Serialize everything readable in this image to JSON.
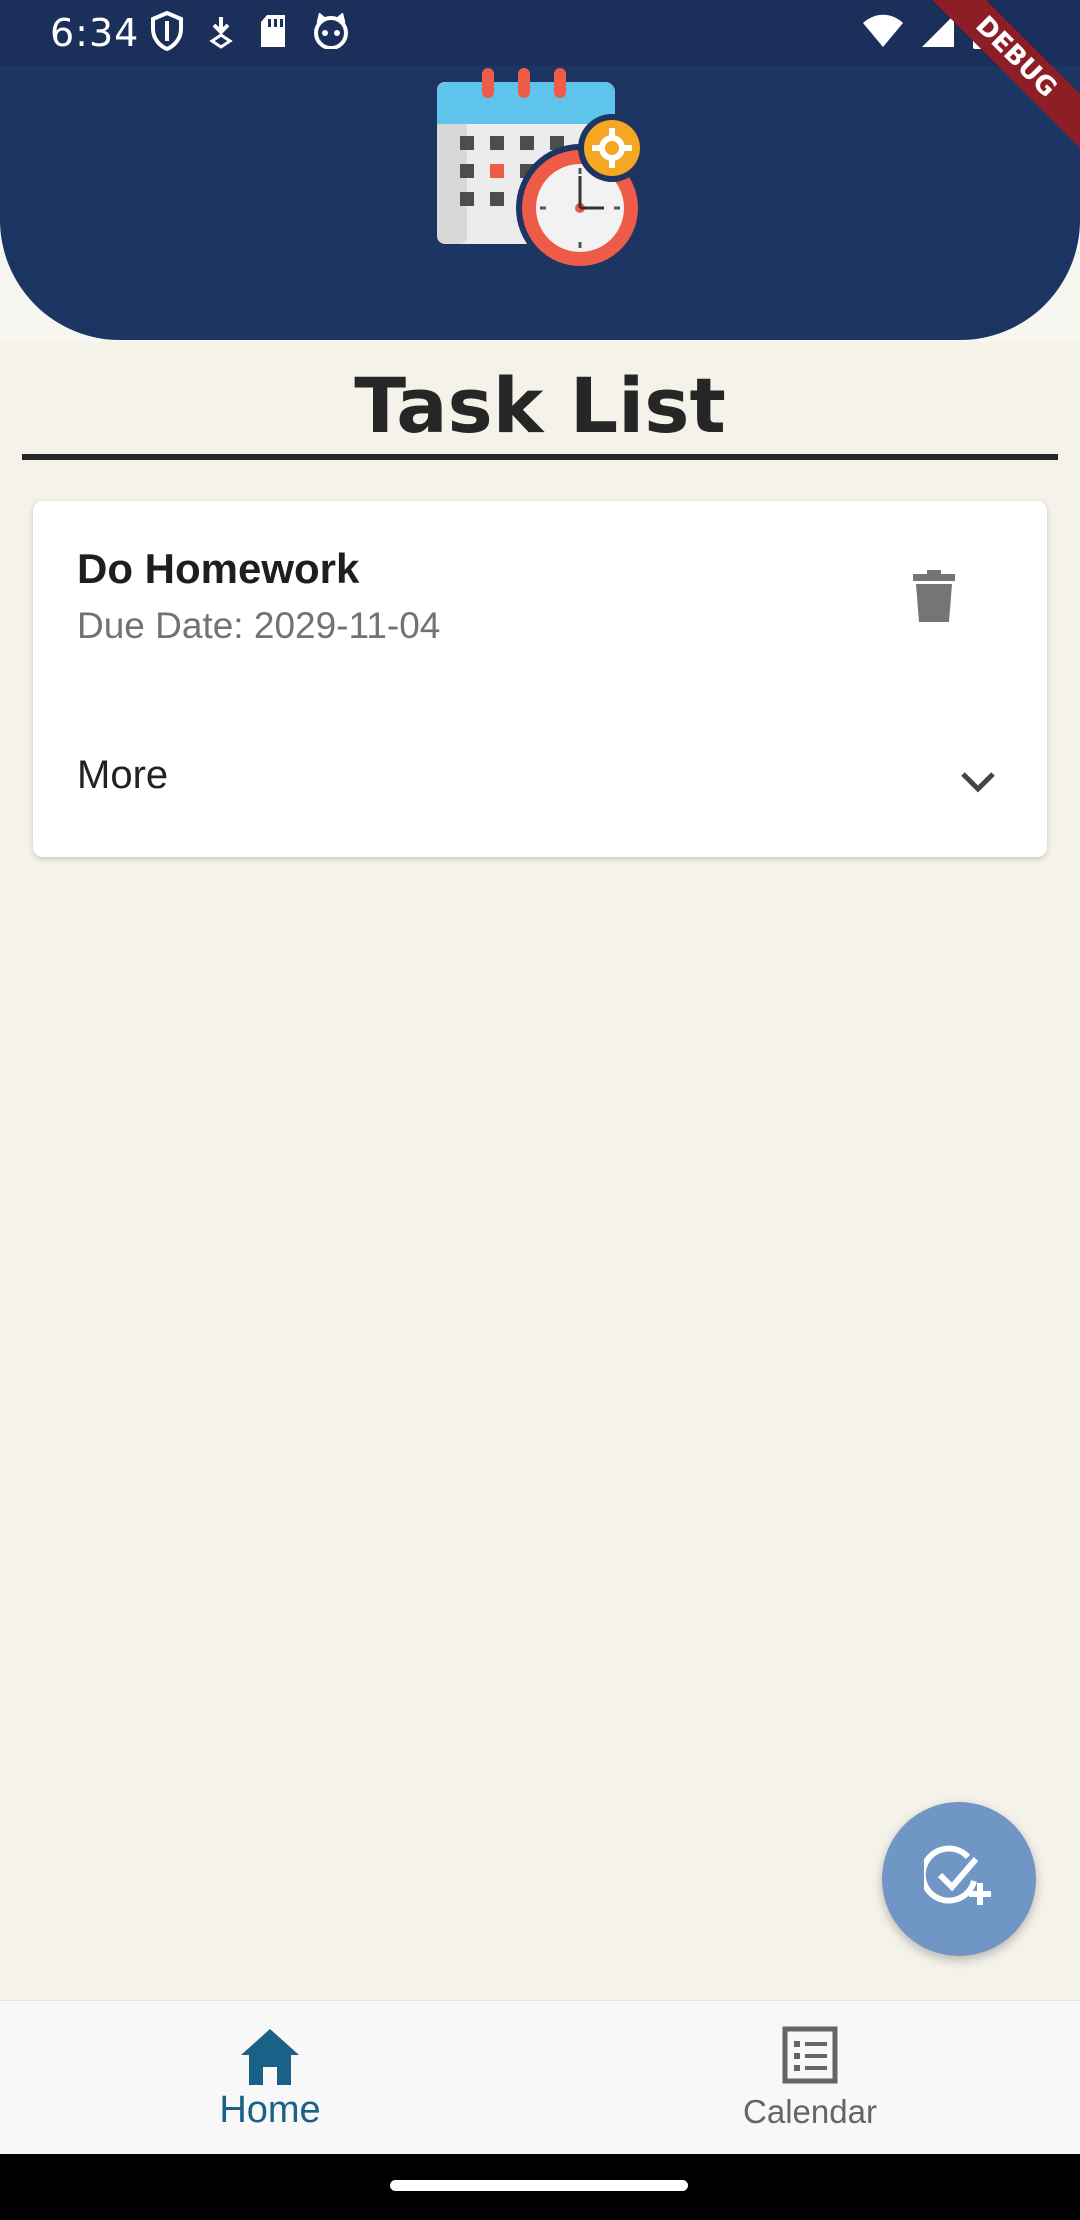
{
  "status_bar": {
    "time": "6:34",
    "left_icons": [
      "shield-icon",
      "download-icon",
      "sd-card-icon",
      "cat-face-icon"
    ],
    "right_icons": [
      "wifi-icon",
      "signal-icon",
      "battery-icon"
    ]
  },
  "debug_banner": {
    "label": "DEBUG"
  },
  "header": {
    "background_color": "#1d3562",
    "logo_icon": "calendar-clock-gear-icon"
  },
  "page": {
    "title": "Task List",
    "background_color": "#f5f2ea"
  },
  "tasks": [
    {
      "title": "Do Homework",
      "due": "Due Date: 2029-11-04",
      "delete_icon": "trash-icon",
      "more_label": "More",
      "expand_icon": "chevron-down-icon"
    }
  ],
  "fab": {
    "icon": "task-add-icon",
    "color": "#6f96c4"
  },
  "bottom_nav": {
    "items": [
      {
        "label": "Home",
        "icon": "home-icon",
        "active": true,
        "color": "#1a6187"
      },
      {
        "label": "Calendar",
        "icon": "calendar-list-icon",
        "active": false,
        "color": "#656565"
      }
    ]
  }
}
